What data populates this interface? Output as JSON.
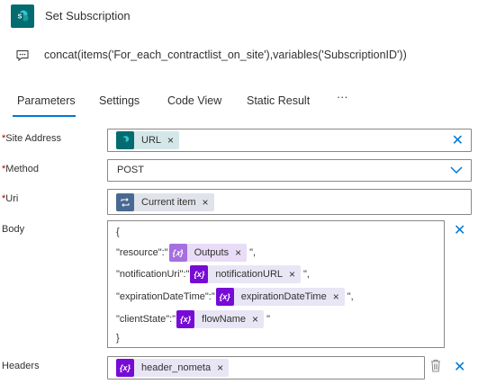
{
  "header": {
    "title": "Set Subscription",
    "app_icon": "sharepoint-icon",
    "brand_color": "#036c70"
  },
  "subtitle": {
    "icon": "comment-icon",
    "text": "concat(items('For_each_contractlist_on_site'),variables('SubscriptionID'))"
  },
  "tabs": {
    "parameters": "Parameters",
    "settings": "Settings",
    "code_view": "Code View",
    "static_result": "Static Result",
    "more": "···",
    "active_color": "#0078d4"
  },
  "fields": {
    "required_mark": "*",
    "site_address": {
      "label": "Site Address",
      "token": "URL"
    },
    "method": {
      "label": "Method",
      "value": "POST"
    },
    "uri": {
      "label": "Uri",
      "token": "Current item"
    },
    "body": {
      "label": "Body",
      "open_brace": "{",
      "close_brace": "}",
      "lines": [
        {
          "key": "\"resource\":\"",
          "token": "Outputs",
          "suffix": "\","
        },
        {
          "key": "\"notificationUri\":\"",
          "token": "notificationURL",
          "suffix": "\","
        },
        {
          "key": "\"expirationDateTime\":\"",
          "token": "expirationDateTime",
          "suffix": "\","
        },
        {
          "key": "\"clientState\":\"",
          "token": "flowName",
          "suffix": "\""
        }
      ]
    },
    "headers": {
      "label": "Headers",
      "token": "header_nometa"
    }
  },
  "icons": {
    "close": "×",
    "clear": "✕",
    "chevron": "chevron-down-icon",
    "delete": "trash-icon"
  },
  "colors": {
    "required": "#a80000",
    "variable": "#770bd6",
    "expression": "#a56fe0",
    "loop": "#486991",
    "accent": "#0078d4"
  }
}
